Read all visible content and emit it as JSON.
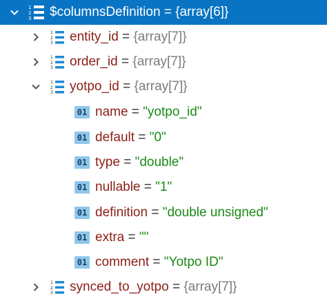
{
  "root": {
    "name": "$columnsDefinition",
    "eq": " = ",
    "value": "{array[6]}"
  },
  "children": [
    {
      "name": "entity_id",
      "eq": " = ",
      "value": "{array[7]}",
      "expanded": false
    },
    {
      "name": "order_id",
      "eq": " = ",
      "value": "{array[7]}",
      "expanded": false
    },
    {
      "name": "yotpo_id",
      "eq": " = ",
      "value": "{array[7]}",
      "expanded": true,
      "items": [
        {
          "name": "name",
          "eq": " = ",
          "value": "\"yotpo_id\""
        },
        {
          "name": "default",
          "eq": " = ",
          "value": "\"0\""
        },
        {
          "name": "type",
          "eq": " = ",
          "value": "\"double\""
        },
        {
          "name": "nullable",
          "eq": " = ",
          "value": "\"1\""
        },
        {
          "name": "definition",
          "eq": " = ",
          "value": "\"double unsigned\""
        },
        {
          "name": "extra",
          "eq": " = ",
          "value": "\"\""
        },
        {
          "name": "comment",
          "eq": " = ",
          "value": "\"Yotpo ID\""
        }
      ]
    },
    {
      "name": "synced_to_yotpo",
      "eq": " = ",
      "value": "{array[7]}",
      "expanded": false
    }
  ],
  "icons": {
    "array": "array-list-icon",
    "primitive": "primitive-01-icon",
    "primitive_glyph": "01"
  },
  "colors": {
    "selection": "#0a74c4",
    "key": "#8a1f17",
    "string": "#1b8a16",
    "array_value": "#7c7c7c",
    "primitive_badge": "#8fc7ea"
  }
}
